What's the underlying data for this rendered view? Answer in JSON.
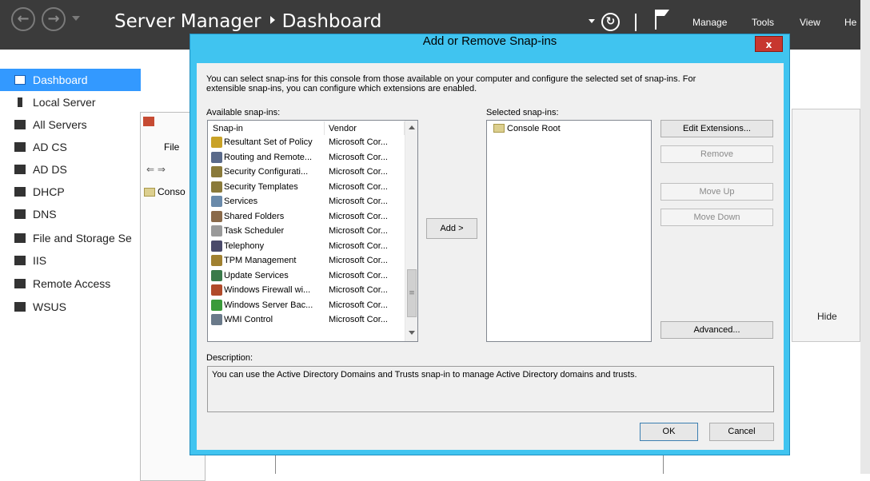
{
  "server_manager": {
    "breadcrumb_root": "Server Manager",
    "breadcrumb_page": "Dashboard",
    "menu": [
      "Manage",
      "Tools",
      "View",
      "He"
    ]
  },
  "sidebar": {
    "items": [
      {
        "label": "Dashboard",
        "icon": "dashboard-icon",
        "active": true
      },
      {
        "label": "Local Server",
        "icon": "server-icon"
      },
      {
        "label": "All Servers",
        "icon": "servers-icon"
      },
      {
        "label": "AD CS",
        "icon": "adcs-icon"
      },
      {
        "label": "AD DS",
        "icon": "adds-icon"
      },
      {
        "label": "DHCP",
        "icon": "dhcp-icon"
      },
      {
        "label": "DNS",
        "icon": "dns-icon"
      },
      {
        "label": "File and Storage Se",
        "icon": "file-storage-icon"
      },
      {
        "label": "IIS",
        "icon": "iis-icon"
      },
      {
        "label": "Remote Access",
        "icon": "remote-access-icon"
      },
      {
        "label": "WSUS",
        "icon": "wsus-icon"
      }
    ]
  },
  "background": {
    "mmc_file_menu": "File",
    "mmc_tree_item": "Conso",
    "hide_label": "Hide"
  },
  "dialog": {
    "title": "Add or Remove Snap-ins",
    "close_label": "x",
    "intro_line1": "You can select snap-ins for this console from those available on your computer and configure the selected set of snap-ins. For",
    "intro_line2": "extensible snap-ins, you can configure which extensions are enabled.",
    "available_label": "Available snap-ins:",
    "selected_label": "Selected snap-ins:",
    "columns": [
      "Snap-in",
      "Vendor"
    ],
    "snapins": [
      {
        "name": "Resultant Set of Policy",
        "vendor": "Microsoft Cor...",
        "icon": "policy-icon",
        "color": "#c9a227"
      },
      {
        "name": "Routing and Remote...",
        "vendor": "Microsoft Cor...",
        "icon": "routing-icon",
        "color": "#5a6a8a"
      },
      {
        "name": "Security Configurati...",
        "vendor": "Microsoft Cor...",
        "icon": "security-config-icon",
        "color": "#8a7a3a"
      },
      {
        "name": "Security Templates",
        "vendor": "Microsoft Cor...",
        "icon": "security-templates-icon",
        "color": "#8a7a3a"
      },
      {
        "name": "Services",
        "vendor": "Microsoft Cor...",
        "icon": "services-gear-icon",
        "color": "#6a8aaa"
      },
      {
        "name": "Shared Folders",
        "vendor": "Microsoft Cor...",
        "icon": "shared-folders-icon",
        "color": "#8a6a4a"
      },
      {
        "name": "Task Scheduler",
        "vendor": "Microsoft Cor...",
        "icon": "clock-icon",
        "color": "#9a9a9a"
      },
      {
        "name": "Telephony",
        "vendor": "Microsoft Cor...",
        "icon": "telephony-icon",
        "color": "#4a4a6a"
      },
      {
        "name": "TPM Management",
        "vendor": "Microsoft Cor...",
        "icon": "tpm-icon",
        "color": "#a08030"
      },
      {
        "name": "Update Services",
        "vendor": "Microsoft Cor...",
        "icon": "update-services-icon",
        "color": "#3a7a4a"
      },
      {
        "name": "Windows Firewall wi...",
        "vendor": "Microsoft Cor...",
        "icon": "firewall-icon",
        "color": "#b04a2a"
      },
      {
        "name": "Windows Server Bac...",
        "vendor": "Microsoft Cor...",
        "icon": "backup-icon",
        "color": "#3a9a3a"
      },
      {
        "name": "WMI Control",
        "vendor": "Microsoft Cor...",
        "icon": "wmi-icon",
        "color": "#6a7a8a"
      }
    ],
    "add_button": "Add >",
    "selected_items": [
      "Console Root"
    ],
    "buttons": {
      "edit_extensions": "Edit Extensions...",
      "remove": "Remove",
      "move_up": "Move Up",
      "move_down": "Move Down",
      "advanced": "Advanced..."
    },
    "description_label": "Description:",
    "description_text": "You can use the Active Directory Domains and Trusts snap-in to manage Active Directory domains and trusts.",
    "ok": "OK",
    "cancel": "Cancel"
  }
}
